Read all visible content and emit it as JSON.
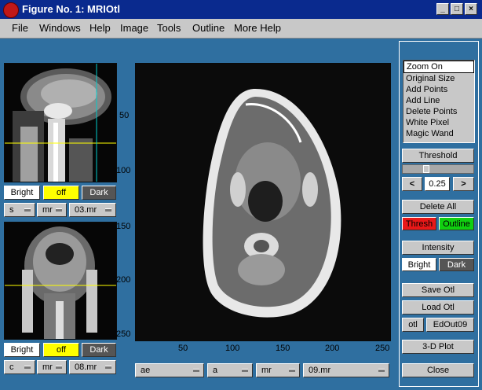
{
  "window": {
    "title": "Figure No. 1: MRIOtl"
  },
  "menu": [
    "File",
    "Windows",
    "Help",
    "Image",
    "Tools",
    "Outline",
    "More Help"
  ],
  "left_top_ticks": [
    "50",
    "100"
  ],
  "left_bottom_ticks": [
    "150",
    "200",
    "250"
  ],
  "main_x_ticks": [
    "50",
    "100",
    "150",
    "200",
    "250"
  ],
  "left_top_controls": {
    "bright": "Bright",
    "off": "off",
    "dark": "Dark",
    "dd1": "s",
    "dd2": "mr",
    "dd3": "03.mr"
  },
  "left_bottom_controls": {
    "bright": "Bright",
    "off": "off",
    "dark": "Dark",
    "dd1": "c",
    "dd2": "mr",
    "dd3": "08.mr"
  },
  "main_controls": {
    "dd1": "ae",
    "dd2": "a",
    "dd3": "mr",
    "dd4": "09.mr"
  },
  "tools": [
    "Zoom On",
    "Original Size",
    "Add Points",
    "Add Line",
    "Delete Points",
    "White Pixel",
    "Magic Wand"
  ],
  "threshold": {
    "label": "Threshold",
    "value": "0.25",
    "prev": "<",
    "next": ">"
  },
  "delete_all": "Delete All",
  "thresh_btn": "Thresh",
  "outline_btn": "Outline",
  "intensity": {
    "label": "Intensity",
    "bright": "Bright",
    "dark": "Dark"
  },
  "save_otl": "Save Otl",
  "load_otl": "Load Otl",
  "otl_btn": "otl",
  "edout_btn": "EdOut09",
  "plot3d": "3-D Plot",
  "close": "Close",
  "colors": {
    "titlebar": "#0a2a8e",
    "background": "#2f6fa0",
    "yellow": "#ffff00",
    "thresh": "#e81818",
    "outline": "#10d010"
  }
}
